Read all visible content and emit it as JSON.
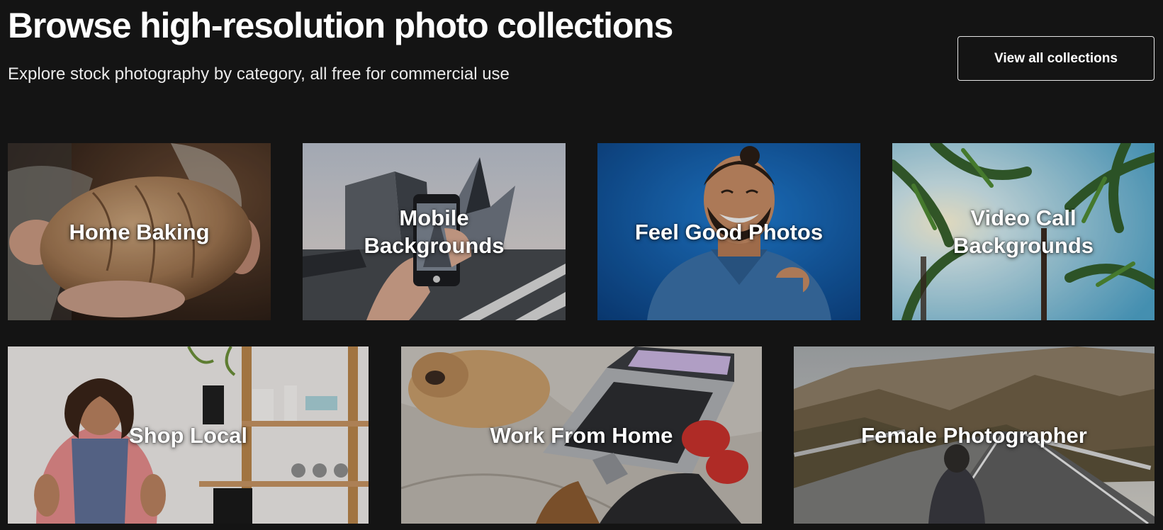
{
  "header": {
    "title": "Browse high-resolution photo collections",
    "subtitle": "Explore stock photography by category, all free for commercial use",
    "view_all_label": "View all collections"
  },
  "collections": [
    {
      "label": "Home Baking",
      "image": "bread-loaf-in-hands-photo"
    },
    {
      "label": "Mobile Backgrounds",
      "image": "phone-photographing-building-photo"
    },
    {
      "label": "Feel Good Photos",
      "image": "laughing-man-pointing-photo"
    },
    {
      "label": "Video Call Backgrounds",
      "image": "palm-trees-sky-photo"
    },
    {
      "label": "Shop Local",
      "image": "shop-owner-shelves-photo"
    },
    {
      "label": "Work From Home",
      "image": "laptop-and-dog-on-bed-photo"
    },
    {
      "label": "Female Photographer",
      "image": "woman-on-mountain-road-photo"
    }
  ],
  "colors": {
    "background": "#141414",
    "text": "#ffffff",
    "button_border": "#e6e6e6"
  }
}
